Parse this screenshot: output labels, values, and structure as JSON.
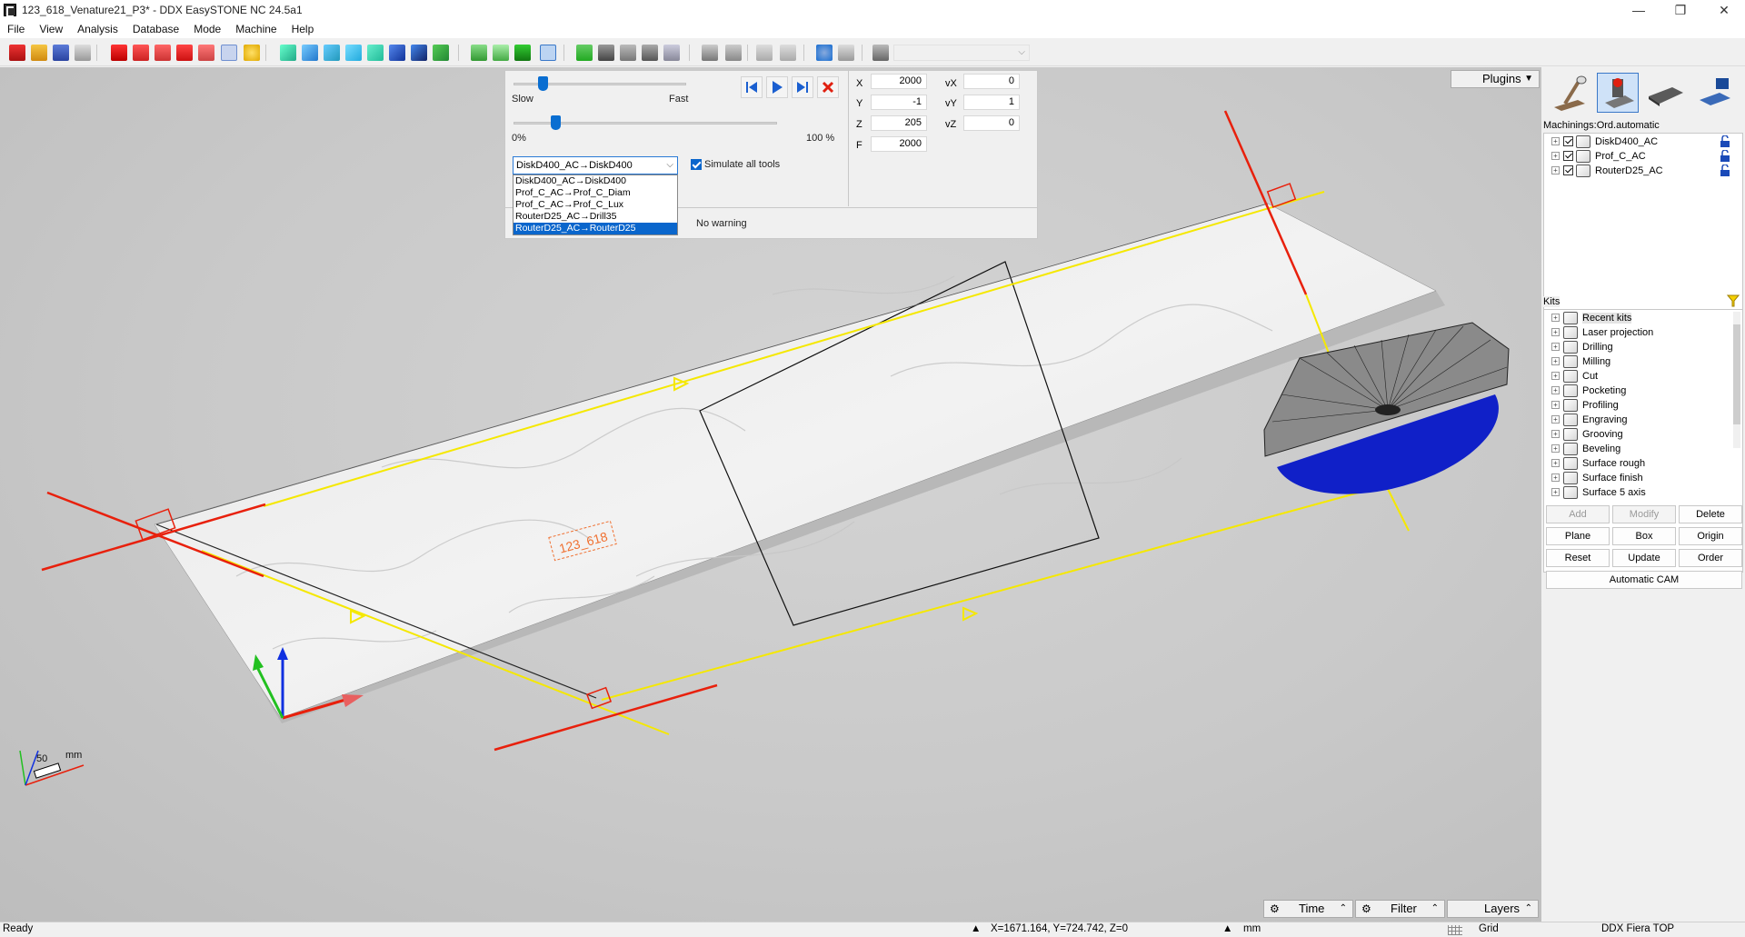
{
  "window": {
    "title": "123_618_Venature21_P3* - DDX EasySTONE NC 24.5a1",
    "minimize": "—",
    "restore": "❐",
    "close": "✕"
  },
  "menu": [
    "File",
    "View",
    "Analysis",
    "Database",
    "Mode",
    "Machine",
    "Help"
  ],
  "simulation": {
    "speed_slow": "Slow",
    "speed_fast": "Fast",
    "speed_level": 0.14,
    "progress_min": "0%",
    "progress_max": "100 %",
    "progress_level": 0.14,
    "tool_selected": "DiskD400_AC→DiskD400",
    "tool_options": [
      "DiskD400_AC→DiskD400",
      "Prof_C_AC→Prof_C_Diam",
      "Prof_C_AC→Prof_C_Lux",
      "RouterD25_AC→Drill35",
      "RouterD25_AC→RouterD25"
    ],
    "selected_option_index": 4,
    "simulate_all_tools": "Simulate all tools",
    "warning": "No warning"
  },
  "coords": {
    "x_label": "X",
    "x": "2000",
    "y_label": "Y",
    "y": "-1",
    "z_label": "Z",
    "z": "205",
    "f_label": "F",
    "f": "2000",
    "vx_label": "vX",
    "vx": "0",
    "vy_label": "vY",
    "vy": "1",
    "vz_label": "vZ",
    "vz": "0"
  },
  "viewport": {
    "part_label": "123_618",
    "scale_label": "50",
    "scale_unit": "mm"
  },
  "right_panel": {
    "plugins": "Plugins",
    "machinings_title": "Machinings:Ord.automatic",
    "machinings": [
      "DiskD400_AC",
      "Prof_C_AC",
      "RouterD25_AC"
    ],
    "kits_title": "Kits",
    "kits": [
      "Recent kits",
      "Laser projection",
      "Drilling",
      "Milling",
      "Cut",
      "Pocketing",
      "Profiling",
      "Engraving",
      "Grooving",
      "Beveling",
      "Surface rough",
      "Surface finish",
      "Surface 5 axis"
    ],
    "buttons": {
      "add": "Add",
      "modify": "Modify",
      "delete": "Delete",
      "plane": "Plane",
      "box": "Box",
      "origin": "Origin",
      "reset": "Reset",
      "update": "Update",
      "order": "Order",
      "automatic_cam": "Automatic CAM"
    }
  },
  "bottom_bar": {
    "time": "Time",
    "filter": "Filter",
    "layers": "Layers"
  },
  "status": {
    "ready": "Ready",
    "cursor": "X=1671.164, Y=724.742, Z=0",
    "unit": "mm",
    "grid": "Grid",
    "machine": "DDX Fiera TOP"
  },
  "colors": {
    "accent": "#0a6ed1",
    "path_yellow": "#f5e800",
    "axis_red": "#e8200c",
    "disk_blue": "#1020c8"
  }
}
